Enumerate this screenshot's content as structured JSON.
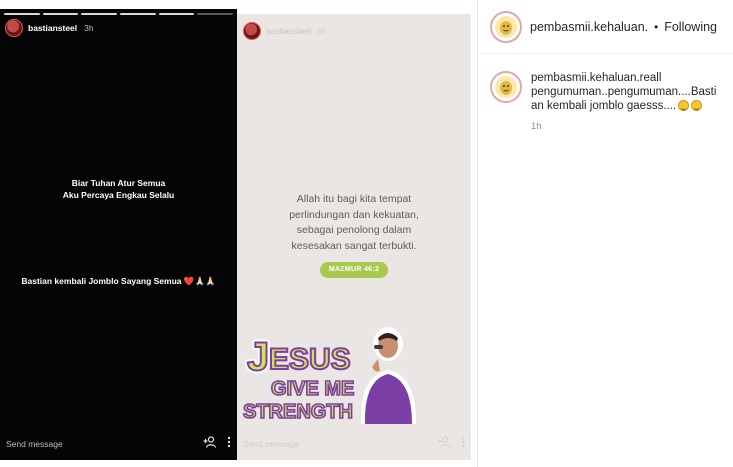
{
  "story_left": {
    "username": "bastiansteel",
    "time": "3h",
    "lines": [
      "Biar Tuhan Atur Semua",
      "Aku Percaya Engkau Selalu"
    ],
    "caption": "Bastian kembali Jomblo Sayang Semua",
    "caption_emoji": "❤️🙏🏻🙏🏻",
    "reply_placeholder": "Send message"
  },
  "story_right": {
    "username": "bastiansteel",
    "time": "3h",
    "verse": [
      "Allah itu bagi kita tempat",
      "perlindungan dan kekuatan,",
      "sebagai penolong dalam",
      "kesesakan sangat terbukti."
    ],
    "verse_ref": "MAZMUR 46:2",
    "sticker_lines": [
      "JESUS",
      "GIVE ME",
      "STRENGTH"
    ],
    "reply_placeholder": "Send message"
  },
  "sidebar": {
    "header_username": "pembasmii.kehaluan.re",
    "separator": "•",
    "follow_label": "Following",
    "comment_username": "pembasmii.kehaluan.reall",
    "comment_text": "pengumuman..pengumuman....Bastian kembali jomblo gaesss....",
    "comment_time": "1h"
  },
  "colors": {
    "accent_green": "#a7c94d",
    "sticker_purple": "#7b3fa6",
    "sticker_yellow": "#d6e24a"
  },
  "icons": [
    "add-user-icon",
    "more-icon",
    "avatar-icon",
    "emoji-icon"
  ]
}
